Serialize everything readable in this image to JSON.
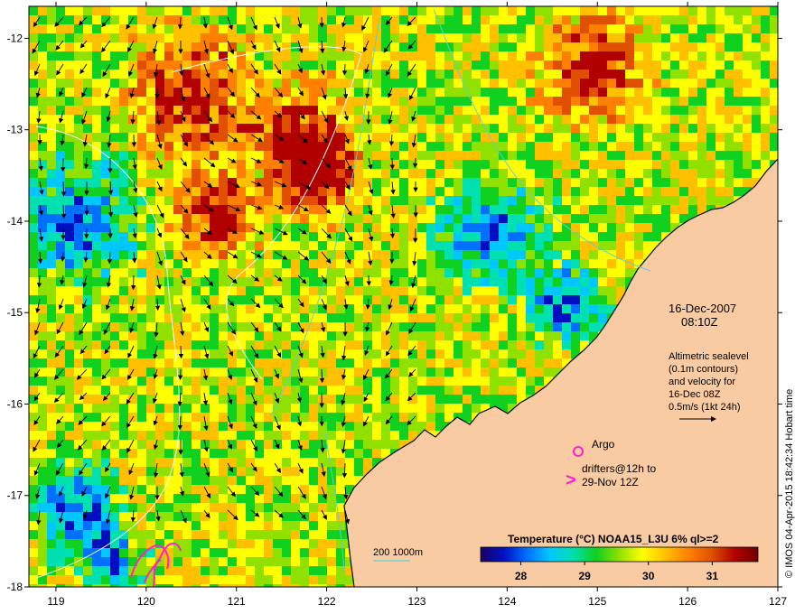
{
  "map": {
    "x_ticks": [
      "119",
      "120",
      "121",
      "122",
      "123",
      "124",
      "125",
      "126",
      "127"
    ],
    "y_ticks": [
      "-12",
      "-13",
      "-14",
      "-15",
      "-16",
      "-17",
      "-18"
    ],
    "lon_range": [
      118.7,
      127
    ],
    "lat_range": [
      -18,
      -11.65
    ],
    "colors": {
      "land": "#f9cba3",
      "frame": "#000000",
      "contour_white": "#ffffff",
      "contour_cyan": "#5ad2d2",
      "drifter_magenta": "#ff22cc"
    }
  },
  "annotations": {
    "date": "16-Dec-2007",
    "time": "08:10Z",
    "alt_line1": "Altimetric sealevel",
    "alt_line2": "(0.1m contours)",
    "alt_line3": "and velocity for",
    "alt_line4": "16-Dec 08Z",
    "alt_line5": "0.5m/s (1kt 24h)",
    "argo_label": "Argo",
    "drifters_line1": "drifters@12h to",
    "drifters_line2": "29-Nov 12Z",
    "drifter_symbol": ">",
    "depth_label": "200  1000m"
  },
  "colorbar": {
    "title": "Temperature (°C) NOAA15_L3U 6% ql>=2",
    "ticks": [
      "28",
      "29",
      "30",
      "31"
    ],
    "stops": [
      "#1a0066",
      "#0010c0",
      "#0070ff",
      "#00c8ff",
      "#00e0b0",
      "#10d020",
      "#90e000",
      "#ffff00",
      "#ffc000",
      "#ff8000",
      "#e05000",
      "#b00000",
      "#700000"
    ]
  },
  "credit": "© IMOS 04-Apr-2015 18:42:34 Hobart time"
}
